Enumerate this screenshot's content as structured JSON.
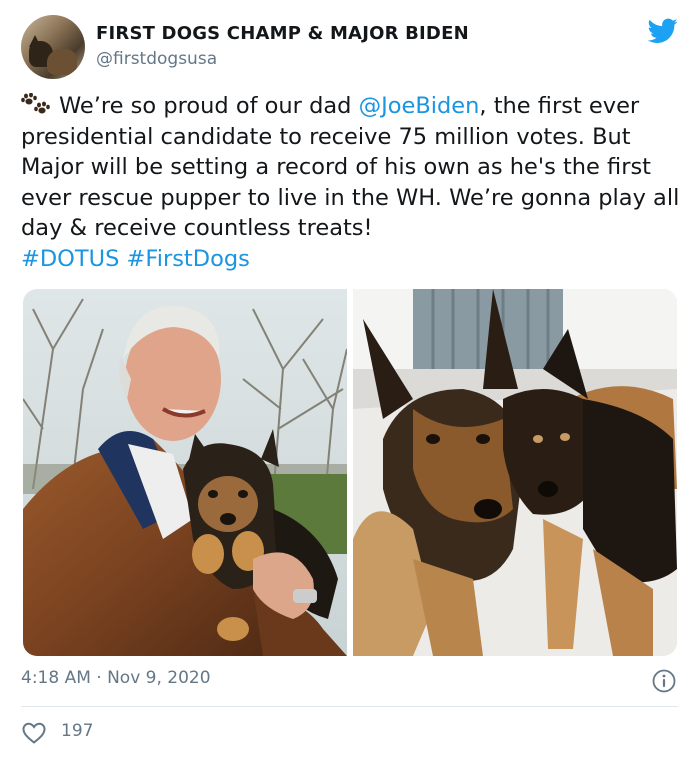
{
  "author": {
    "name": "FIRST DOGS CHAMP & MAJOR BIDEN",
    "handle": "@firstdogsusa",
    "avatar_icon": "avatar-photo"
  },
  "tweet": {
    "paw_icon": "paw-prints-icon",
    "text_before_mention": "We’re so proud of our dad ",
    "mention": "@JoeBiden",
    "text_after_mention": ", the first ever presidential candidate to receive 75 million votes. But Major will be setting a record of his own as he's the first ever rescue pupper to live in the WH. We’re gonna play all day & receive countless treats!",
    "hashtag1": "#DOTUS",
    "hashtag2": "#FirstDogs"
  },
  "media": {
    "left_photo": "man-holding-puppy-photo",
    "right_photo": "two-german-shepherds-photo"
  },
  "meta": {
    "timestamp": "4:18 AM · Nov 9, 2020",
    "likes": "197"
  },
  "colors": {
    "link": "#1b95e0",
    "twitter_blue": "#1da1f2",
    "secondary_text": "#657786",
    "primary_text": "#14171a"
  }
}
